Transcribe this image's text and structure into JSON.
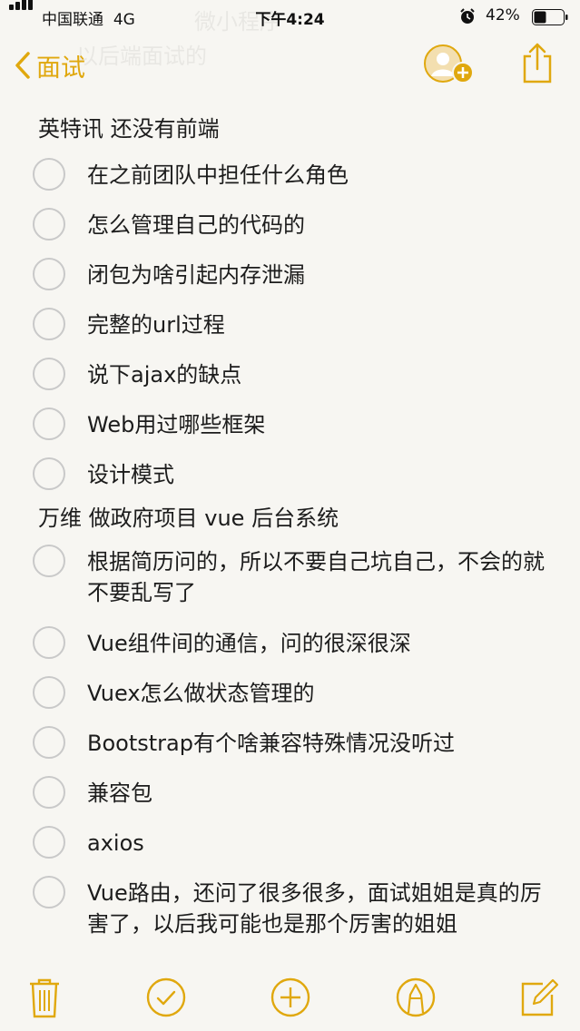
{
  "status_bar": {
    "carrier": "中国联通",
    "network": "4G",
    "time": "下午4:24",
    "battery": "42%",
    "battery_level": 0.42
  },
  "ghost_text": [
    "微小程序",
    "以后端面试的"
  ],
  "nav": {
    "back_label": "面试"
  },
  "sections": [
    {
      "title": "英特讯  还没有前端",
      "items": [
        "在之前团队中担任什么角色",
        "怎么管理自己的代码的",
        "闭包为啥引起内存泄漏",
        "完整的url过程",
        "说下ajax的缺点",
        "Web用过哪些框架",
        "设计模式"
      ]
    },
    {
      "title": "万维 做政府项目 vue 后台系统",
      "items": [
        "根据简历问的，所以不要自己坑自己，不会的就不要乱写了",
        "Vue组件间的通信，问的很深很深",
        "Vuex怎么做状态管理的",
        "Bootstrap有个啥兼容特殊情况没听过",
        "兼容包",
        "axios",
        "Vue路由，还问了很多很多，面试姐姐是真的厉害了，以后我可能也是那个厉害的姐姐"
      ]
    }
  ],
  "colors": {
    "accent": "#e0a80e",
    "checkbox": "#c9c9c9",
    "background": "#f7f6f2"
  }
}
